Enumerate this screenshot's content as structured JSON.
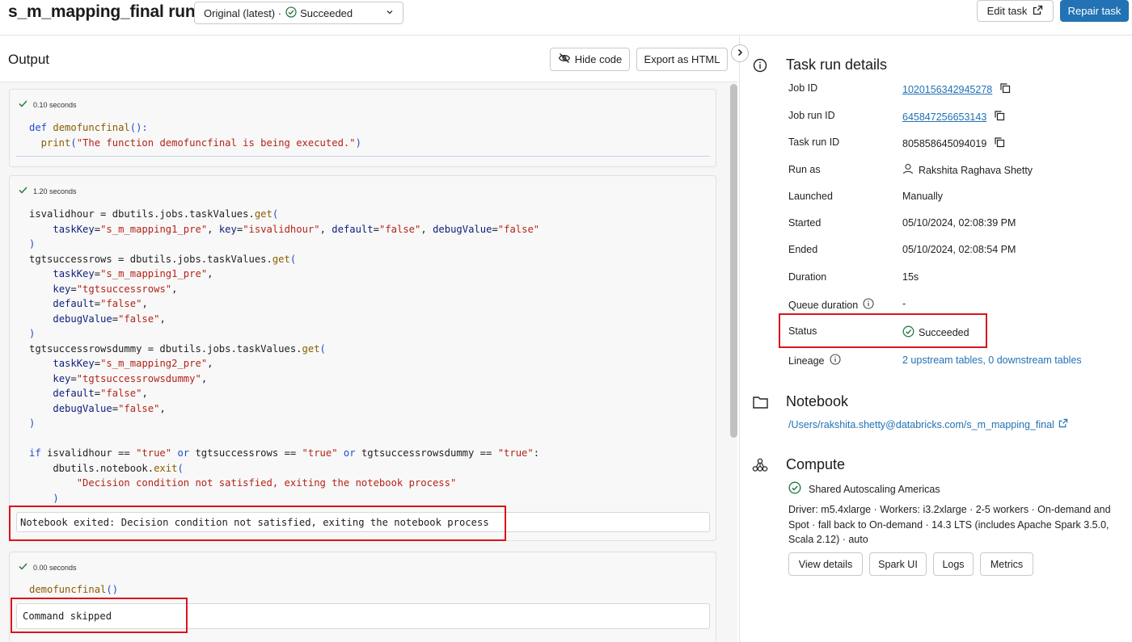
{
  "header": {
    "title": "s_m_mapping_final run",
    "run_selector": {
      "text": "Original (latest) ·",
      "status": "Succeeded"
    },
    "edit_task_label": "Edit task",
    "repair_task_label": "Repair task"
  },
  "output": {
    "title": "Output",
    "hide_code_label": "Hide code",
    "export_label": "Export as HTML",
    "cells": [
      {
        "time": "0.10 seconds",
        "code": [
          [
            [
              "kw",
              "def "
            ],
            [
              "fn",
              "demofuncfinal"
            ],
            [
              "kw",
              "():"
            ]
          ],
          [
            [
              "",
              ""
            ],
            [
              "fn",
              "  print"
            ],
            [
              "kw",
              "("
            ],
            [
              "st",
              "\"The function demofuncfinal is being executed.\""
            ],
            [
              "kw",
              ")"
            ]
          ]
        ]
      },
      {
        "time": "1.20 seconds",
        "code": [
          [
            [
              "",
              "isvalidhour = dbutils.jobs.taskValues."
            ],
            [
              "fn",
              "get"
            ],
            [
              "kw",
              "("
            ]
          ],
          [
            [
              "",
              "    "
            ],
            [
              "kv",
              "taskKey"
            ],
            [
              "",
              "="
            ],
            [
              "st",
              "\"s_m_mapping1_pre\""
            ],
            [
              "",
              ", "
            ],
            [
              "kv",
              "key"
            ],
            [
              "",
              "="
            ],
            [
              "st",
              "\"isvalidhour\""
            ],
            [
              "",
              ", "
            ],
            [
              "kv",
              "default"
            ],
            [
              "",
              "="
            ],
            [
              "st",
              "\"false\""
            ],
            [
              "",
              ", "
            ],
            [
              "kv",
              "debugValue"
            ],
            [
              "",
              "="
            ],
            [
              "st",
              "\"false\""
            ]
          ],
          [
            [
              "kw",
              ")"
            ]
          ],
          [
            [
              "",
              "tgtsuccessrows = dbutils.jobs.taskValues."
            ],
            [
              "fn",
              "get"
            ],
            [
              "kw",
              "("
            ]
          ],
          [
            [
              "",
              "    "
            ],
            [
              "kv",
              "taskKey"
            ],
            [
              "",
              "="
            ],
            [
              "st",
              "\"s_m_mapping1_pre\""
            ],
            [
              "",
              ","
            ]
          ],
          [
            [
              "",
              "    "
            ],
            [
              "kv",
              "key"
            ],
            [
              "",
              "="
            ],
            [
              "st",
              "\"tgtsuccessrows\""
            ],
            [
              "",
              ","
            ]
          ],
          [
            [
              "",
              "    "
            ],
            [
              "kv",
              "default"
            ],
            [
              "",
              "="
            ],
            [
              "st",
              "\"false\""
            ],
            [
              "",
              ","
            ]
          ],
          [
            [
              "",
              "    "
            ],
            [
              "kv",
              "debugValue"
            ],
            [
              "",
              "="
            ],
            [
              "st",
              "\"false\""
            ],
            [
              "",
              ","
            ]
          ],
          [
            [
              "kw",
              ")"
            ]
          ],
          [
            [
              "",
              "tgtsuccessrowsdummy = dbutils.jobs.taskValues."
            ],
            [
              "fn",
              "get"
            ],
            [
              "kw",
              "("
            ]
          ],
          [
            [
              "",
              "    "
            ],
            [
              "kv",
              "taskKey"
            ],
            [
              "",
              "="
            ],
            [
              "st",
              "\"s_m_mapping2_pre\""
            ],
            [
              "",
              ","
            ]
          ],
          [
            [
              "",
              "    "
            ],
            [
              "kv",
              "key"
            ],
            [
              "",
              "="
            ],
            [
              "st",
              "\"tgtsuccessrowsdummy\""
            ],
            [
              "",
              ","
            ]
          ],
          [
            [
              "",
              "    "
            ],
            [
              "kv",
              "default"
            ],
            [
              "",
              "="
            ],
            [
              "st",
              "\"false\""
            ],
            [
              "",
              ","
            ]
          ],
          [
            [
              "",
              "    "
            ],
            [
              "kv",
              "debugValue"
            ],
            [
              "",
              "="
            ],
            [
              "st",
              "\"false\""
            ],
            [
              "",
              ","
            ]
          ],
          [
            [
              "kw",
              ")"
            ]
          ],
          [
            [
              "",
              ""
            ]
          ],
          [
            [
              "kw",
              "if "
            ],
            [
              "",
              "isvalidhour == "
            ],
            [
              "st",
              "\"true\""
            ],
            [
              "kw",
              " or "
            ],
            [
              "",
              "tgtsuccessrows == "
            ],
            [
              "st",
              "\"true\""
            ],
            [
              "kw",
              " or "
            ],
            [
              "",
              "tgtsuccessrowsdummy == "
            ],
            [
              "st",
              "\"true\""
            ],
            [
              "",
              ":"
            ]
          ],
          [
            [
              "",
              "    dbutils.notebook."
            ],
            [
              "fn",
              "exit"
            ],
            [
              "kw",
              "("
            ]
          ],
          [
            [
              "",
              "        "
            ],
            [
              "st",
              "\"Decision condition not satisfied, exiting the notebook process\""
            ]
          ],
          [
            [
              "",
              "    "
            ],
            [
              "kw",
              ")"
            ]
          ]
        ],
        "output_text": "Notebook exited: Decision condition not satisfied, exiting the notebook process"
      },
      {
        "time": "0.00 seconds",
        "code": [
          [
            [
              "fn",
              "demofuncfinal"
            ],
            [
              "kw",
              "()"
            ]
          ]
        ],
        "output_text": "Command skipped"
      }
    ]
  },
  "details": {
    "title": "Task run details",
    "job_id": {
      "label": "Job ID",
      "value": "1020156342945278"
    },
    "job_run_id": {
      "label": "Job run ID",
      "value": "645847256653143"
    },
    "task_run_id": {
      "label": "Task run ID",
      "value": "805858645094019"
    },
    "run_as": {
      "label": "Run as",
      "value": "Rakshita Raghava Shetty"
    },
    "launched": {
      "label": "Launched",
      "value": "Manually"
    },
    "started": {
      "label": "Started",
      "value": "05/10/2024, 02:08:39 PM"
    },
    "ended": {
      "label": "Ended",
      "value": "05/10/2024, 02:08:54 PM"
    },
    "duration": {
      "label": "Duration",
      "value": "15s"
    },
    "queue_duration": {
      "label": "Queue duration",
      "value": "-"
    },
    "status": {
      "label": "Status",
      "value": "Succeeded"
    },
    "lineage": {
      "label": "Lineage",
      "value": "2 upstream tables, 0 downstream tables"
    }
  },
  "notebook": {
    "title": "Notebook",
    "path": "/Users/rakshita.shetty@databricks.com/s_m_mapping_final"
  },
  "compute": {
    "title": "Compute",
    "cluster_name": "Shared Autoscaling Americas",
    "desc_lines": [
      "Driver: m5.4xlarge · Workers: i3.2xlarge · 2-5 workers · On-demand and",
      "Spot · fall back to On-demand · 14.3 LTS (includes Apache Spark 3.5.0,",
      "Scala 2.12) · auto"
    ],
    "buttons": [
      "View details",
      "Spark UI",
      "Logs",
      "Metrics"
    ]
  },
  "colors": {
    "accent": "#2272b4",
    "success": "#277c43",
    "highlight": "#d9141b"
  }
}
